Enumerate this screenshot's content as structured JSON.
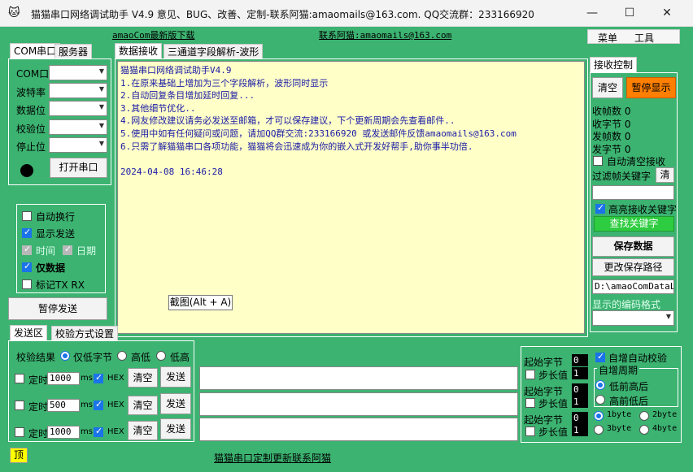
{
  "window": {
    "title": "猫猫串口网络调试助手 V4.9 意见、BUG、改善、定制-联系阿猫:amaomails@163.com. QQ交流群：233166920",
    "minimize": "—",
    "maximize": "☐",
    "close": "✕"
  },
  "links": {
    "download": "amaoCom最新版下载",
    "contact": "联系阿猫:amaomails@163.com",
    "footer": "猫猫串口定制更新联系阿猫"
  },
  "menu": {
    "menu_label": "菜单",
    "tools_label": "工具"
  },
  "left_tabs": {
    "com": "COM串口",
    "server": "服务器"
  },
  "serial": {
    "labels": [
      "COM口",
      "波特率",
      "数据位",
      "校验位",
      "停止位"
    ],
    "open_button": "打开串口"
  },
  "options": {
    "auto_wrap": "自动换行",
    "show_send": "显示发送",
    "time": "时间",
    "date": "日期",
    "data_only": "仅数据",
    "mark_tx_rx": "标记TX RX"
  },
  "pause_send": "暂停发送",
  "center_tabs": {
    "receive": "数据接收",
    "triple": "三通道字段解析-波形"
  },
  "receive_lines": [
    "猫猫串口网络调试助手V4.9",
    "1.在原来基础上增加为三个字段解析，波形同时显示",
    "2.自动回复条目增加延时回复...",
    "3.其他细节优化..",
    "4.网友修改建议请务必发送至邮箱，才可以保存建议，下个更新周期会先查看邮件..",
    "5.使用中如有任何疑问或问题，请加QQ群交流:233166920 或发送邮件反馈amaomails@163.com",
    "6.只需了解猫猫串口各项功能，猫猫将会迅速成为你的嵌入式开发好帮手,助你事半功倍.",
    "",
    "2024-04-08 16:46:28"
  ],
  "tooltip": "截图(Alt + A)",
  "recv_ctrl": {
    "tab": "接收控制",
    "clear": "清空",
    "pause_display": "暂停显示",
    "stats": [
      "收帧数 0",
      "收字节 0",
      "发帧数 0",
      "发字节 0"
    ],
    "auto_clear": "自动清空接收",
    "filter_keyword": "过滤帧关键字",
    "filter_clear": "清",
    "highlight": "高亮接收关键字",
    "find": "查找关键字",
    "save": "保存数据",
    "change_path": "更改保存路径",
    "path_value": "D:\\amaoComDataLo",
    "encoding_label": "显示的编码格式"
  },
  "send_tabs": {
    "send": "发送区",
    "checksum": "校验方式设置"
  },
  "send": {
    "check_result": "校验结果",
    "low_byte": "仅低字节",
    "high_low": "高低",
    "low_high": "低高",
    "timer_label": "定时",
    "ms": "ms",
    "hex": "HEX",
    "clear": "清空",
    "send": "发送",
    "intervals": [
      "1000",
      "500",
      "1000"
    ]
  },
  "checksum": {
    "start_byte": "起始字节",
    "start_vals": [
      "0",
      "0",
      "0"
    ],
    "step": "步长值",
    "step_vals": [
      "1",
      "1",
      "1"
    ],
    "auto_inc": "自增自动校验",
    "period": "自增周期",
    "low_first": "低前高后",
    "high_first": "高前低后",
    "byte1": "1byte",
    "byte2": "2byte",
    "byte3": "3byte",
    "byte4": "4byte"
  },
  "topmost": "顶"
}
